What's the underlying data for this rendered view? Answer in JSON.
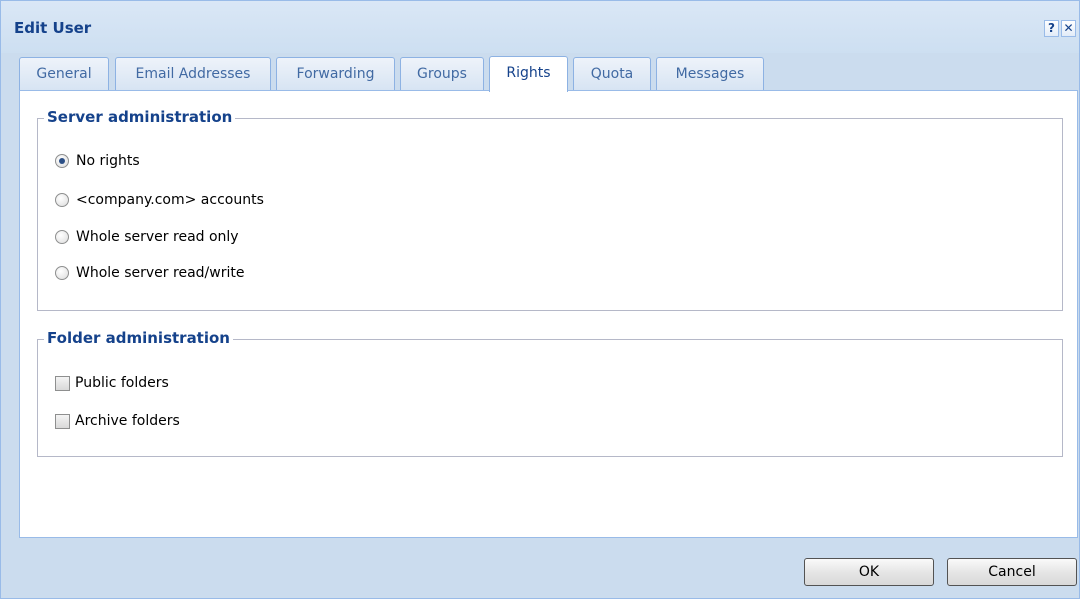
{
  "window": {
    "title": "Edit User",
    "help_label": "?",
    "close_label": "✕"
  },
  "tabs": [
    {
      "label": "General",
      "active": false
    },
    {
      "label": "Email Addresses",
      "active": false
    },
    {
      "label": "Forwarding",
      "active": false
    },
    {
      "label": "Groups",
      "active": false
    },
    {
      "label": "Rights",
      "active": true
    },
    {
      "label": "Quota",
      "active": false
    },
    {
      "label": "Messages",
      "active": false
    }
  ],
  "server_admin": {
    "legend": "Server administration",
    "options": [
      {
        "label": "No rights",
        "checked": true
      },
      {
        "label": "<company.com> accounts",
        "checked": false
      },
      {
        "label": "Whole server read only",
        "checked": false
      },
      {
        "label": "Whole server read/write",
        "checked": false
      }
    ]
  },
  "folder_admin": {
    "legend": "Folder administration",
    "options": [
      {
        "label": "Public folders",
        "checked": false
      },
      {
        "label": "Archive folders",
        "checked": false
      }
    ]
  },
  "buttons": {
    "ok_label": "OK",
    "cancel_label": "Cancel"
  }
}
